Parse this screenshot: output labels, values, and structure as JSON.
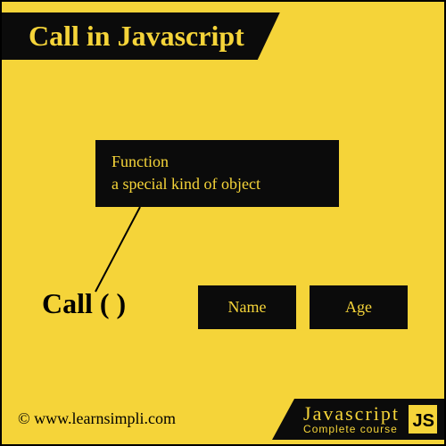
{
  "title": "Call in Javascript",
  "function_box": {
    "line1": "Function",
    "line2": "a special kind of object"
  },
  "call_label": "Call ( )",
  "properties": {
    "name": "Name",
    "age": "Age"
  },
  "watermark": "© www.learnsimpli.com",
  "footer": {
    "main": "Javascript",
    "sub": "Complete course",
    "badge": "JS"
  }
}
